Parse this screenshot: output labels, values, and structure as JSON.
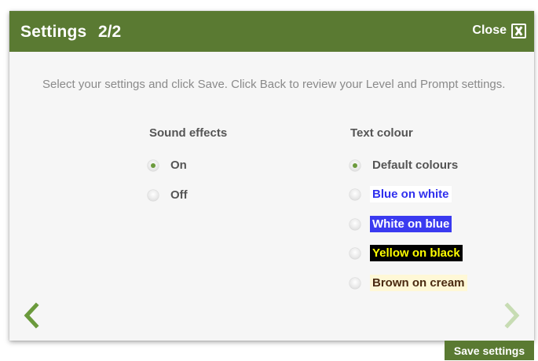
{
  "header": {
    "title": "Settings",
    "page_indicator": "2/2",
    "close_label": "Close"
  },
  "instructions": "Select your settings and click Save. Click Back to review your Level and Prompt settings.",
  "sound_effects": {
    "heading": "Sound effects",
    "options": [
      {
        "label": "On",
        "selected": true
      },
      {
        "label": "Off",
        "selected": false
      }
    ]
  },
  "text_colour": {
    "heading": "Text colour",
    "options": [
      {
        "label": "Default colours",
        "selected": true
      },
      {
        "label": "Blue on white",
        "selected": false
      },
      {
        "label": "White on blue",
        "selected": false
      },
      {
        "label": "Yellow on black",
        "selected": false
      },
      {
        "label": "Brown on cream",
        "selected": false
      }
    ]
  },
  "navigation": {
    "back_icon": "chevron-left-icon",
    "next_icon": "chevron-right-icon",
    "next_enabled": false
  },
  "footer": {
    "save_label": "Save settings"
  },
  "colors": {
    "brand_green": "#5a7a32",
    "selected_radio": "#6b9a3c"
  }
}
